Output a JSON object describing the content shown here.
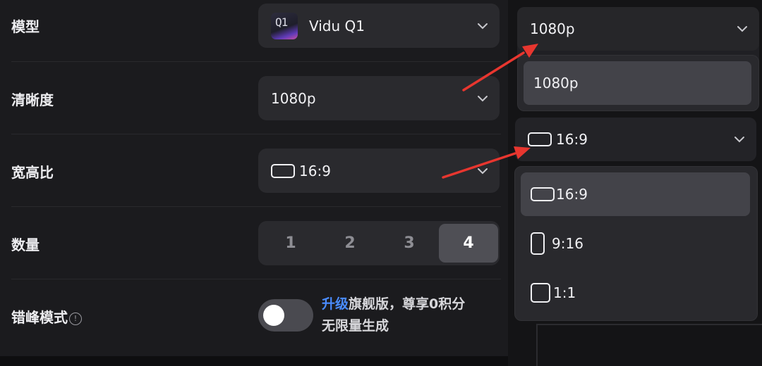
{
  "settings": {
    "model": {
      "label": "模型",
      "value": "Vidu Q1",
      "logo_text": "Q1"
    },
    "resolution": {
      "label": "清晰度",
      "value": "1080p"
    },
    "aspect_ratio": {
      "label": "宽高比",
      "value": "16:9"
    },
    "quantity": {
      "label": "数量",
      "options": [
        "1",
        "2",
        "3",
        "4"
      ],
      "selected": "4"
    },
    "staggered_mode": {
      "label": "错峰模式",
      "info_icon": "!",
      "enabled": false,
      "promo_link": "升级",
      "promo_line1_rest": "旗舰版，尊享0积分",
      "promo_line2": "无限量生成"
    }
  },
  "resolution_dropdown": {
    "value": "1080p",
    "options": [
      "1080p"
    ],
    "selected": "1080p"
  },
  "ratio_dropdown": {
    "value": "16:9",
    "options": [
      "16:9",
      "9:16",
      "1:1"
    ],
    "selected": "16:9"
  },
  "colors": {
    "panel": "#1b1b1e",
    "control": "#2a2a2e",
    "accent_link": "#4a8cff",
    "annotation_arrow": "#e8362f"
  }
}
